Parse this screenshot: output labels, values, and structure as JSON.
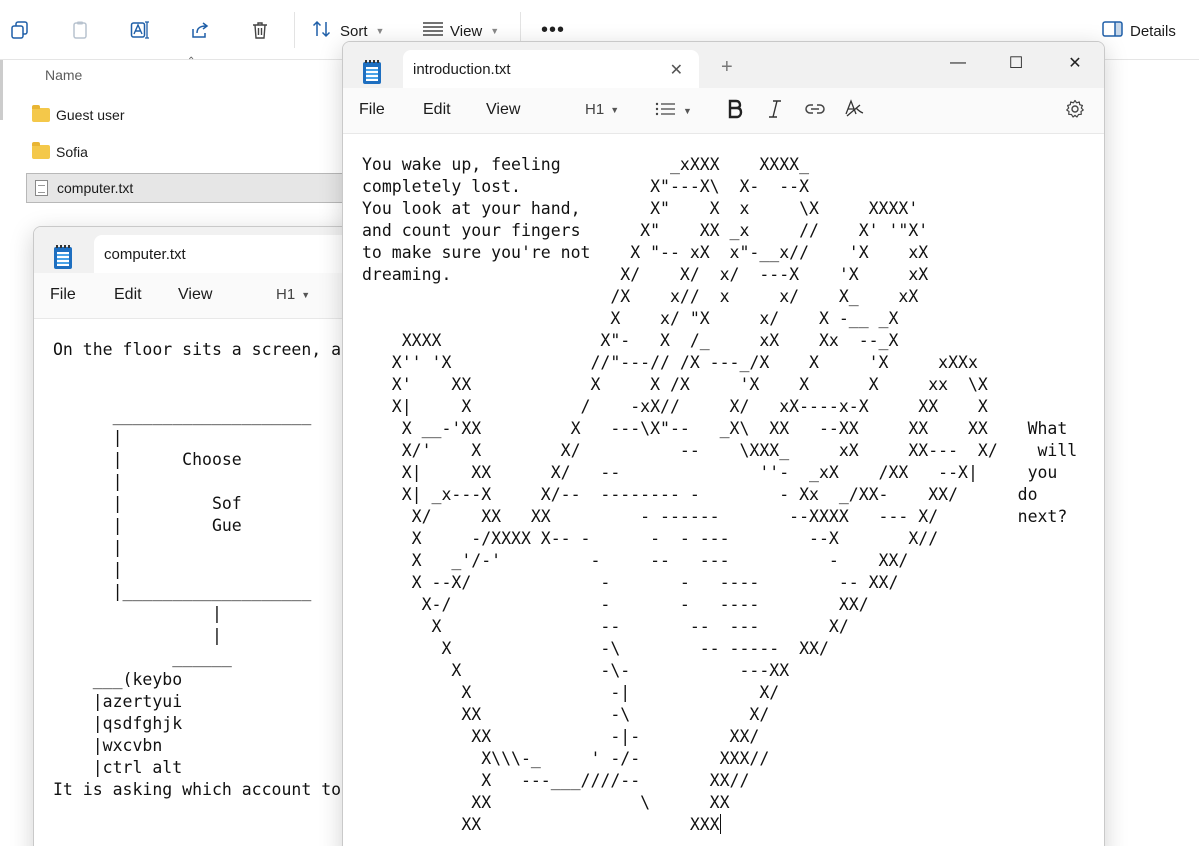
{
  "explorer": {
    "toolbar": {
      "sort_label": "Sort",
      "view_label": "View",
      "more_label": "•••",
      "details_label": "Details",
      "icons": [
        "copy-icon",
        "paste-icon",
        "rename-icon",
        "share-icon",
        "delete-icon",
        "sort-icon",
        "view-icon",
        "details-pane-icon"
      ]
    },
    "column_header": "Name",
    "files": [
      {
        "name": "Guest user",
        "type": "folder"
      },
      {
        "name": "Sofia",
        "type": "folder"
      },
      {
        "name": "computer.txt",
        "type": "text",
        "selected": true
      }
    ],
    "colors": {
      "folder": "#f4c84a",
      "icon_accent": "#1f5fa8"
    }
  },
  "notepad_back": {
    "tab_title": "computer.txt",
    "menu": {
      "file": "File",
      "edit": "Edit",
      "view": "View",
      "heading": "H1"
    },
    "content": "On the floor sits a screen, a\n\n\n      ____________________\n      |\n      |      Choose\n      |\n      |         Sof\n      |         Gue\n      |\n      |\n      |___________________\n                |\n                |\n            ______\n    ___(keybo\n    |azertyui\n    |qsdfghjk\n    |wxcvbn\n    |ctrl alt\nIt is asking which account to"
  },
  "notepad_front": {
    "tab_title": "introduction.txt",
    "menu": {
      "file": "File",
      "edit": "Edit",
      "view": "View",
      "heading": "H1"
    },
    "window_controls": {
      "minimize": "—",
      "maximize": "☐",
      "close": "✕"
    },
    "new_tab": "+",
    "content": "You wake up, feeling           _xXXX    XXXX_\ncompletely lost.             X\"---X\\  X-  --X\nYou look at your hand,       X\"    X  x     \\X     XXXX'\nand count your fingers      X\"    XX _x     //    X' '\"X'\nto make sure you're not    X \"-- xX  x\"-__x//    'X    xX\ndreaming.                 X/    X/  x/  ---X    'X     xX\n                         /X    x//  x     x/    X_    xX\n                         X    x/ \"X     x/    X -__ _X\n    XXXX                X\"-   X  /_     xX    Xx  --_X\n   X'' 'X              //\"---// /X ---_/X    X     'X     xXXx\n   X'    XX            X     X /X     'X    X      X     xx  \\X\n   X|     X           /    -xX//     X/   xX----x-X     XX    X\n    X __-'XX         X   ---\\X\"--   _X\\  XX   --XX     XX    XX    What\n    X/'    X        X/          --    \\XXX_     xX     XX---  X/    will\n    X|     XX      X/   --              ''-  _xX    /XX   --X|     you\n    X| _x---X     X/--  -------- -        - Xx  _/XX-    XX/      do\n     X/     XX   XX         - ------       --XXXX   --- X/        next?\n     X     -/XXXX X-- -      -  - ---        --X       X//\n     X   _'/-'         -     --   ---          -    XX/\n     X --X/             -       -   ----        -- XX/\n      X-/               -       -   ----        XX/\n       X                --       --  ---       X/\n        X               -\\        -- -----  XX/\n         X              -\\-           ---XX\n          X              -|             X/\n          XX             -\\            X/\n           XX            -|-         XX/\n            X\\\\\\-_     ' -/-        XXX//\n            X   ---___////--       XX//\n           XX               \\      XX\n          XX                     XXX"
  }
}
